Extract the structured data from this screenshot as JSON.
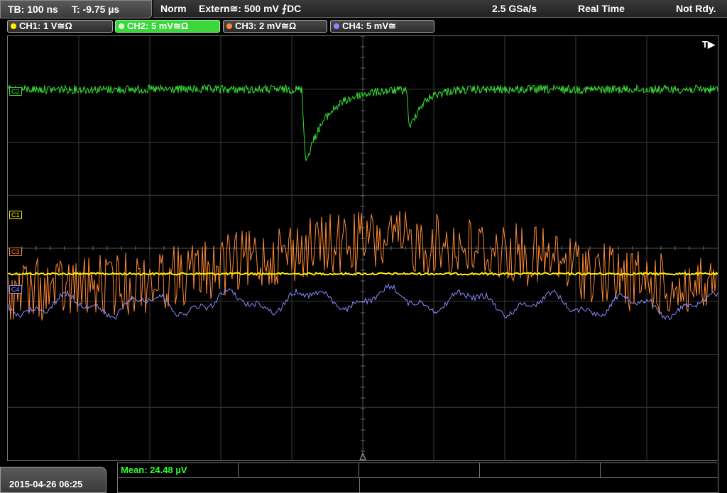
{
  "header": {
    "timebase": "TB: 100 ns",
    "trigger_time": "T: -9.75 µs",
    "mode": "Norm",
    "trigger_source": "Extern≅: 500 mV ⨍DC",
    "sample_rate": "2.5 GSa/s",
    "acq_mode": "Real Time",
    "state": "Not Rdy."
  },
  "channels": [
    {
      "label": "CH1: 1 V≅Ω",
      "color": "#ffee00"
    },
    {
      "label": "CH2: 5 mV≅Ω",
      "color": "#33dd33"
    },
    {
      "label": "CH3: 2 mV≅Ω",
      "color": "#ff8a33"
    },
    {
      "label": "CH4: 5 mV≅",
      "color": "#8a8aff"
    }
  ],
  "markers": {
    "c1": "C1",
    "c2": "C2",
    "c3": "C3",
    "c4": "C4",
    "trigger": "T▶"
  },
  "footer": {
    "datetime": "2015-04-26 06:25",
    "measurement": "Mean: 24.48 µV"
  }
}
